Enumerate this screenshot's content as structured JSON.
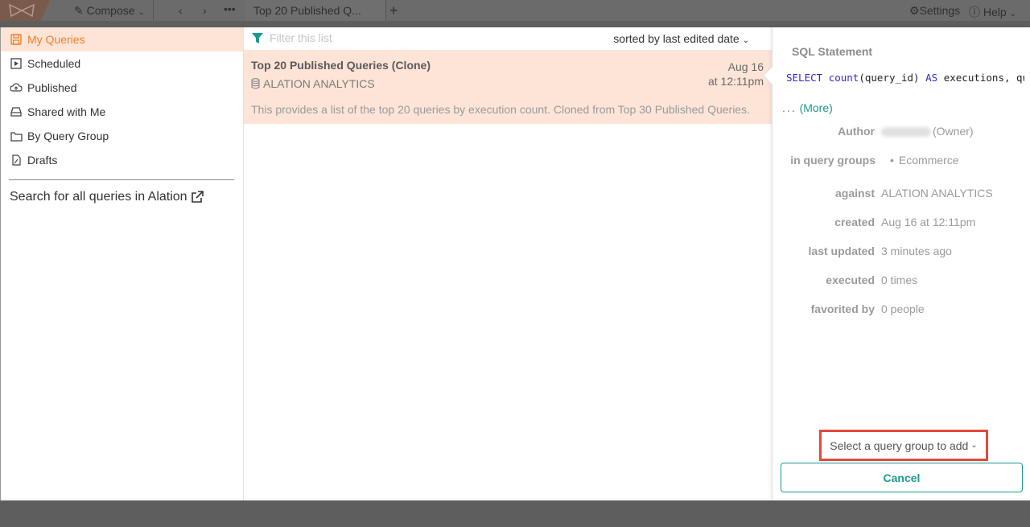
{
  "topbar": {
    "compose_label": "Compose",
    "tab_title": "Top 20 Published Q...",
    "tab_more": "...",
    "add_tab": "+",
    "settings_label": "Settings",
    "help_label": "Help"
  },
  "sidebar": {
    "items": [
      {
        "label": "My Queries",
        "icon": "save-icon"
      },
      {
        "label": "Scheduled",
        "icon": "play-icon"
      },
      {
        "label": "Published",
        "icon": "cloud-icon"
      },
      {
        "label": "Shared with Me",
        "icon": "inbox-icon"
      },
      {
        "label": "By Query Group",
        "icon": "folder-icon"
      },
      {
        "label": "Drafts",
        "icon": "draft-icon"
      }
    ],
    "search_all_link": "Search for all queries in Alation"
  },
  "list": {
    "filter_placeholder": "Filter this list",
    "sort_label": "sorted by last edited date",
    "queries": [
      {
        "title": "Top 20 Published Queries (Clone)",
        "datasource": "ALATION ANALYTICS",
        "date_line1": "Aug 16",
        "date_line2": "at 12:11pm",
        "description": "This provides a list of the top 20 queries by execution count. Cloned from Top 30 Published Queries."
      }
    ]
  },
  "detail": {
    "sql_label": "SQL Statement",
    "sql_kw1": "SELECT",
    "sql_fn": "count",
    "sql_mid": "(query_id) ",
    "sql_kw2": "AS",
    "sql_tail": " executions, que",
    "more_dots": "...",
    "more_link": "(More)",
    "author_label": "Author",
    "author_suffix": "(Owner)",
    "groups_label": "in query groups",
    "groups_value": "Ecommerce",
    "against_label": "against",
    "against_value": "ALATION ANALYTICS",
    "created_label": "created",
    "created_value": "Aug 16 at 12:11pm",
    "updated_label": "last updated",
    "updated_value": "3 minutes ago",
    "executed_label": "executed",
    "executed_value": "0 times",
    "favorited_label": "favorited by",
    "favorited_value": "0 people",
    "group_select_label": "Select a query group to add",
    "cancel_label": "Cancel"
  },
  "colors": {
    "accent_orange": "#f07f2c",
    "teal": "#1a9b8c",
    "highlight_row": "#fde4d6",
    "annotation_red": "#e4473b"
  }
}
